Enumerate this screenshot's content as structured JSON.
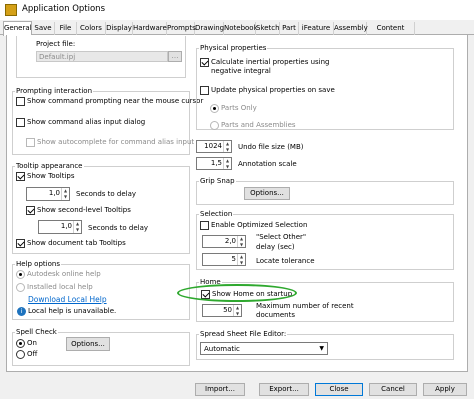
{
  "window": {
    "title": "Application Options"
  },
  "tabs": [
    "General",
    "Save",
    "File",
    "Colors",
    "Display",
    "Hardware",
    "Prompts",
    "Drawing",
    "Notebook",
    "Sketch",
    "Part",
    "iFeature",
    "Assembly",
    "Content Center"
  ],
  "project": {
    "label": "Project file:",
    "value": "Default.ipj"
  },
  "prompting": {
    "title": "Prompting interaction",
    "show_prompting": "Show command prompting near the mouse cursor",
    "show_alias": "Show command alias input dialog",
    "show_autocomplete": "Show autocomplete for command alias input"
  },
  "tooltip": {
    "title": "Tooltip appearance",
    "show_tooltips": "Show Tooltips",
    "delay1_value": "1,0",
    "delay1_label": "Seconds to delay",
    "show_second": "Show second-level Tooltips",
    "delay2_value": "1,0",
    "delay2_label": "Seconds to delay",
    "show_doc_tab": "Show document tab Tooltips"
  },
  "help": {
    "title": "Help options",
    "online": "Autodesk online help",
    "installed": "Installed local help",
    "download": "Download Local Help",
    "unavailable": "Local help is unavailable."
  },
  "spell": {
    "title": "Spell Check",
    "on": "On",
    "off": "Off",
    "options": "Options..."
  },
  "physical": {
    "title": "Physical properties",
    "calc_inertial": "Calculate inertial properties using negative integral",
    "update_on_save": "Update physical properties on save",
    "parts_only": "Parts Only",
    "parts_assemblies": "Parts and Assemblies"
  },
  "undo": {
    "value": "1024",
    "label": "Undo file size (MB)"
  },
  "annotation": {
    "value": "1,5",
    "label": "Annotation scale"
  },
  "grip": {
    "title": "Grip Snap",
    "options": "Options..."
  },
  "selection": {
    "title": "Selection",
    "enable_optimized": "Enable Optimized Selection",
    "select_other_value": "2,0",
    "select_other_label_1": "\"Select Other\"",
    "select_other_label_2": "delay (sec)",
    "locate_value": "5",
    "locate_label": "Locate tolerance"
  },
  "home": {
    "title": "Home",
    "show_home": "Show Home on startup",
    "max_value": "50",
    "max_label_1": "Maximum number of recent",
    "max_label_2": "documents"
  },
  "spreadsheet": {
    "title": "Spread Sheet File Editor:",
    "value": "Automatic"
  },
  "bottom": {
    "import": "Import...",
    "export": "Export...",
    "close": "Close",
    "cancel": "Cancel",
    "apply": "Apply"
  },
  "colors": {
    "accent": "#0078d7",
    "highlight_ellipse": "#2ea82e",
    "link": "#0066cc"
  }
}
